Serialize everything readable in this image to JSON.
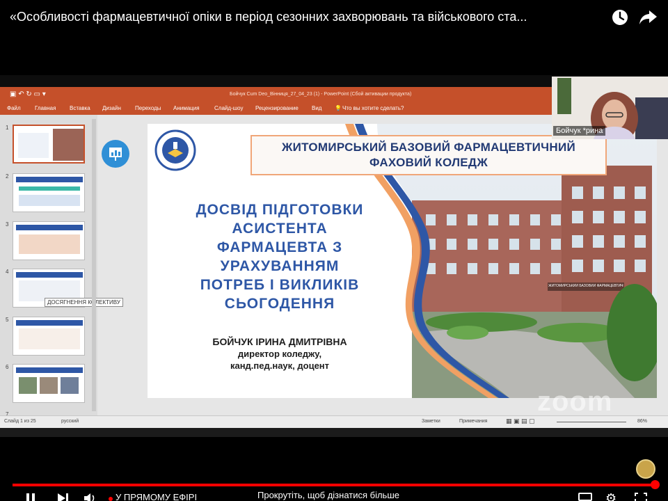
{
  "youtube": {
    "title": "«Особливості фармацевтичної опіки в період сезонних захворювань та військового ста...",
    "watch_later_icon": "clock-icon",
    "share_icon": "share-icon",
    "live_label": "У ПРЯМОМУ ЕФІРІ",
    "scroll_hint": "Прокрутіть, щоб дізнатися більше",
    "progress": 1.0,
    "accent": "#ff0000"
  },
  "powerpoint": {
    "window_title": "Бойчук Сum Deo_Вінниця_27_04_23 (1) - PowerPoint (Сбой активации продукта)",
    "ribbon_tabs": [
      "Файл",
      "Главная",
      "Вставка",
      "Дизайн",
      "Переходы",
      "Анимация",
      "Слайд-шоу",
      "Рецензирование",
      "Вид"
    ],
    "tell_me": "Что вы хотите сделать?",
    "thumbnail_numbers": [
      "1",
      "2",
      "3",
      "4",
      "5",
      "6",
      "7"
    ],
    "hover_tooltip": "ДОСЯГНЕННЯ КОЛЕКТИВУ",
    "status_slide": "Слайд 1 из 25",
    "status_lang": "русский",
    "notes_label": "Заметки",
    "comments_label": "Примечания",
    "zoom_level": "86%",
    "brand_color": "#c5502a"
  },
  "slide": {
    "college_name": "ЖИТОМИРСЬКИЙ БАЗОВИЙ ФАРМАЦЕВТИЧНИЙ ФАХОВИЙ КОЛЕДЖ",
    "title_lines": [
      "ДОСВІД ПІДГОТОВКИ",
      "АСИСТЕНТА",
      "ФАРМАЦЕВТА З",
      "УРАХУВАННЯМ",
      "ПОТРЕБ І ВИКЛИКІВ",
      "СЬОГОДЕННЯ"
    ],
    "author_name": "БОЙЧУК ІРИНА ДМИТРІВНА",
    "author_role": "директор коледжу,",
    "author_degree": "канд.пед.наук, доцент",
    "building_sign": "ЖИТОМИРСЬКИЙ БАЗОВИЙ ФАРМАЦЕВТИЧНИЙ КОЛЕДЖ",
    "title_color": "#2e57a6"
  },
  "webcam": {
    "name": "Бойчук *рина"
  },
  "watermark": "zoom"
}
